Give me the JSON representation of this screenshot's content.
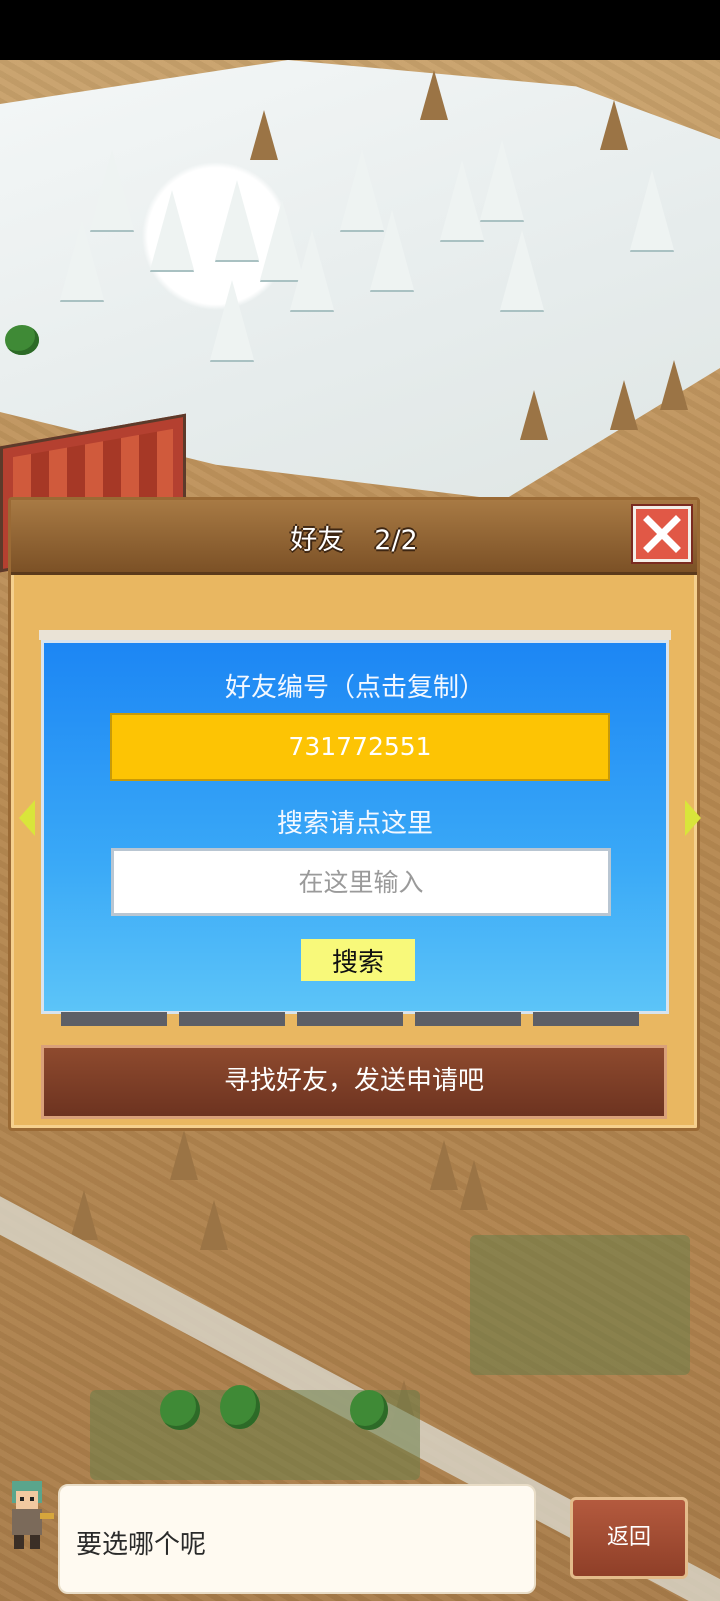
{
  "dialog": {
    "title": "好友",
    "page_indicator": "2/2",
    "friend_code_label": "好友编号（点击复制）",
    "friend_code": "731772551",
    "search_label": "搜索请点这里",
    "search_placeholder": "在这里输入",
    "search_button": "搜索",
    "banner_text": "寻找好友，发送申请吧"
  },
  "bottom": {
    "speech_text": "要选哪个呢",
    "back_button": "返回"
  },
  "colors": {
    "panel_blue": "#1c86f4",
    "code_yellow": "#fdc404",
    "close_red": "#e15846",
    "banner_brown": "#7d3d26"
  },
  "icons": [
    "close-icon",
    "arrow-left-icon",
    "arrow-right-icon",
    "avatar-character-icon"
  ]
}
